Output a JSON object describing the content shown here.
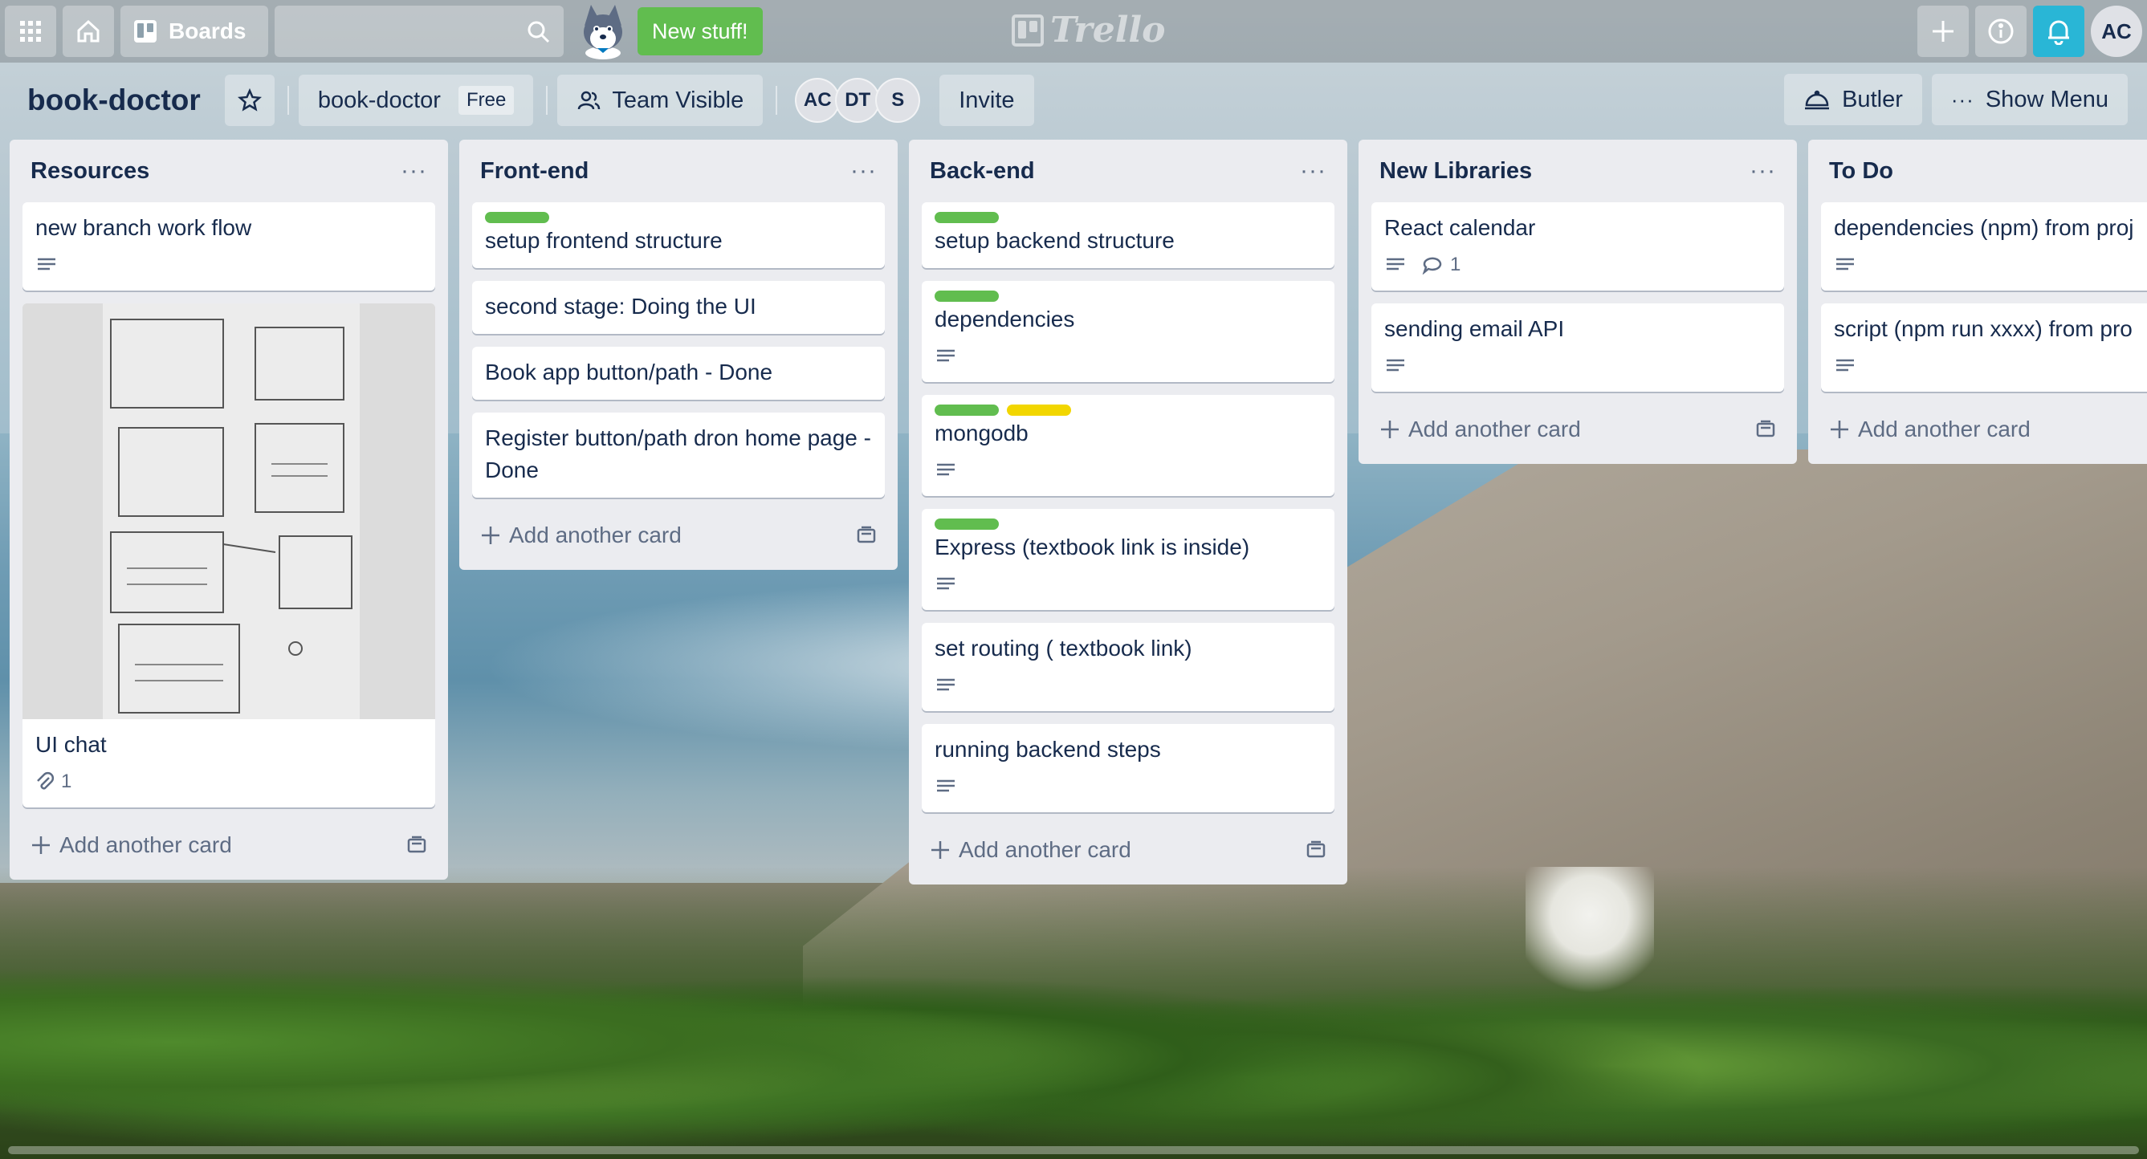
{
  "nav": {
    "boards_label": "Boards",
    "new_stuff_label": "New stuff!",
    "logo_text": "Trello",
    "avatar": "AC"
  },
  "header": {
    "board_title": "book-doctor",
    "board_name": "book-doctor",
    "plan_badge": "Free",
    "visibility": "Team Visible",
    "members": [
      "AC",
      "DT",
      "S"
    ],
    "invite_label": "Invite",
    "butler_label": "Butler",
    "show_menu_label": "Show Menu"
  },
  "colors": {
    "green_label": "#61bd4f",
    "yellow_label": "#f2d600",
    "bell": "#29b6d6"
  },
  "lists": [
    {
      "title": "Resources",
      "add_label": "Add another card",
      "cards": [
        {
          "title": "new branch work flow",
          "labels": [],
          "badges": [
            "description"
          ]
        },
        {
          "title": "UI chat",
          "cover": true,
          "labels": [],
          "badges": [
            "attachment"
          ],
          "attachments": "1"
        }
      ]
    },
    {
      "title": "Front-end",
      "add_label": "Add another card",
      "cards": [
        {
          "title": "setup frontend structure",
          "labels": [
            "green"
          ],
          "badges": []
        },
        {
          "title": "second stage: Doing the UI",
          "labels": [],
          "badges": []
        },
        {
          "title": "Book app button/path - Done",
          "labels": [],
          "badges": []
        },
        {
          "title": "Register button/path dron home page - Done",
          "labels": [],
          "badges": []
        }
      ]
    },
    {
      "title": "Back-end",
      "add_label": "Add another card",
      "cards": [
        {
          "title": "setup backend structure",
          "labels": [
            "green"
          ],
          "badges": []
        },
        {
          "title": "dependencies",
          "labels": [
            "green"
          ],
          "badges": [
            "description"
          ]
        },
        {
          "title": "mongodb",
          "labels": [
            "green",
            "yellow"
          ],
          "badges": [
            "description"
          ]
        },
        {
          "title": "Express (textbook link is inside)",
          "labels": [
            "green"
          ],
          "badges": [
            "description"
          ]
        },
        {
          "title": "set routing ( textbook link)",
          "labels": [],
          "badges": [
            "description"
          ]
        },
        {
          "title": "running backend steps",
          "labels": [],
          "badges": [
            "description"
          ]
        }
      ]
    },
    {
      "title": "New Libraries",
      "add_label": "Add another card",
      "cards": [
        {
          "title": "React calendar",
          "labels": [],
          "badges": [
            "description",
            "comments"
          ],
          "comments": "1"
        },
        {
          "title": "sending email API",
          "labels": [],
          "badges": [
            "description"
          ]
        }
      ]
    },
    {
      "title": "To Do",
      "add_label": "Add another card",
      "cards": [
        {
          "title": "dependencies (npm) from proj",
          "labels": [],
          "badges": [
            "description"
          ]
        },
        {
          "title": "script (npm run xxxx) from pro",
          "labels": [],
          "badges": [
            "description"
          ]
        }
      ]
    }
  ]
}
